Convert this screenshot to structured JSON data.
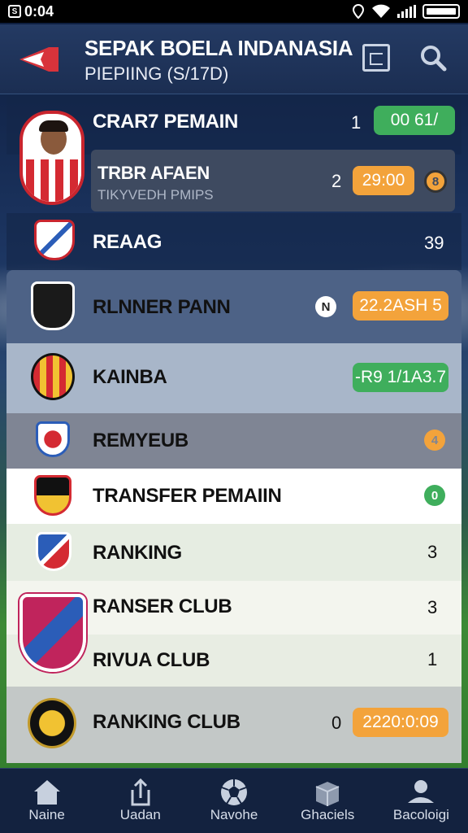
{
  "status": {
    "time": "0:04",
    "corner": "S"
  },
  "header": {
    "title": "SEPAK BOELA INDANASIA",
    "subtitle": "PIEPIING (S/17D)",
    "icons": [
      "calendar-icon",
      "search-icon"
    ]
  },
  "rows": [
    {
      "title": "CRAR7 PEMAIN",
      "num": "1",
      "pill": "00   61/",
      "pill_color": "#3fae5c"
    },
    {
      "title": "TRBR AFAEN",
      "subtitle": "TIKYVEDH PMIPS",
      "num": "2",
      "pill": "29:00",
      "pill_color": "#f3a33b",
      "dot": "8"
    },
    {
      "title": "REAAG",
      "num": "39"
    },
    {
      "title": "RLNNER PANN",
      "dot": "N",
      "pill": "22.2ASH 5",
      "pill_color": "#f3a33b"
    },
    {
      "title": "KAINBA",
      "pill": "-R9 1/1A3.7",
      "pill_color": "#3fae5c"
    },
    {
      "title": "REMYEUB",
      "dot": "4"
    },
    {
      "title": "TRANSFER PEMAIIN",
      "dot": "0"
    },
    {
      "title": "RANKING",
      "num": "3"
    },
    {
      "title": "RANSER CLUB",
      "num": "3"
    },
    {
      "title": "RIVUA CLUB",
      "num": "1"
    },
    {
      "title": "RANKING CLUB",
      "num": "0",
      "pill": "2220:0:09",
      "pill_color": "#f3a33b"
    }
  ],
  "nav": [
    {
      "label": "Naine",
      "icon": "home-icon"
    },
    {
      "label": "Uadan",
      "icon": "share-icon"
    },
    {
      "label": "Navohe",
      "icon": "football-icon"
    },
    {
      "label": "Ghaciels",
      "icon": "box-icon"
    },
    {
      "label": "Bacoloigi",
      "icon": "profile-icon"
    }
  ]
}
